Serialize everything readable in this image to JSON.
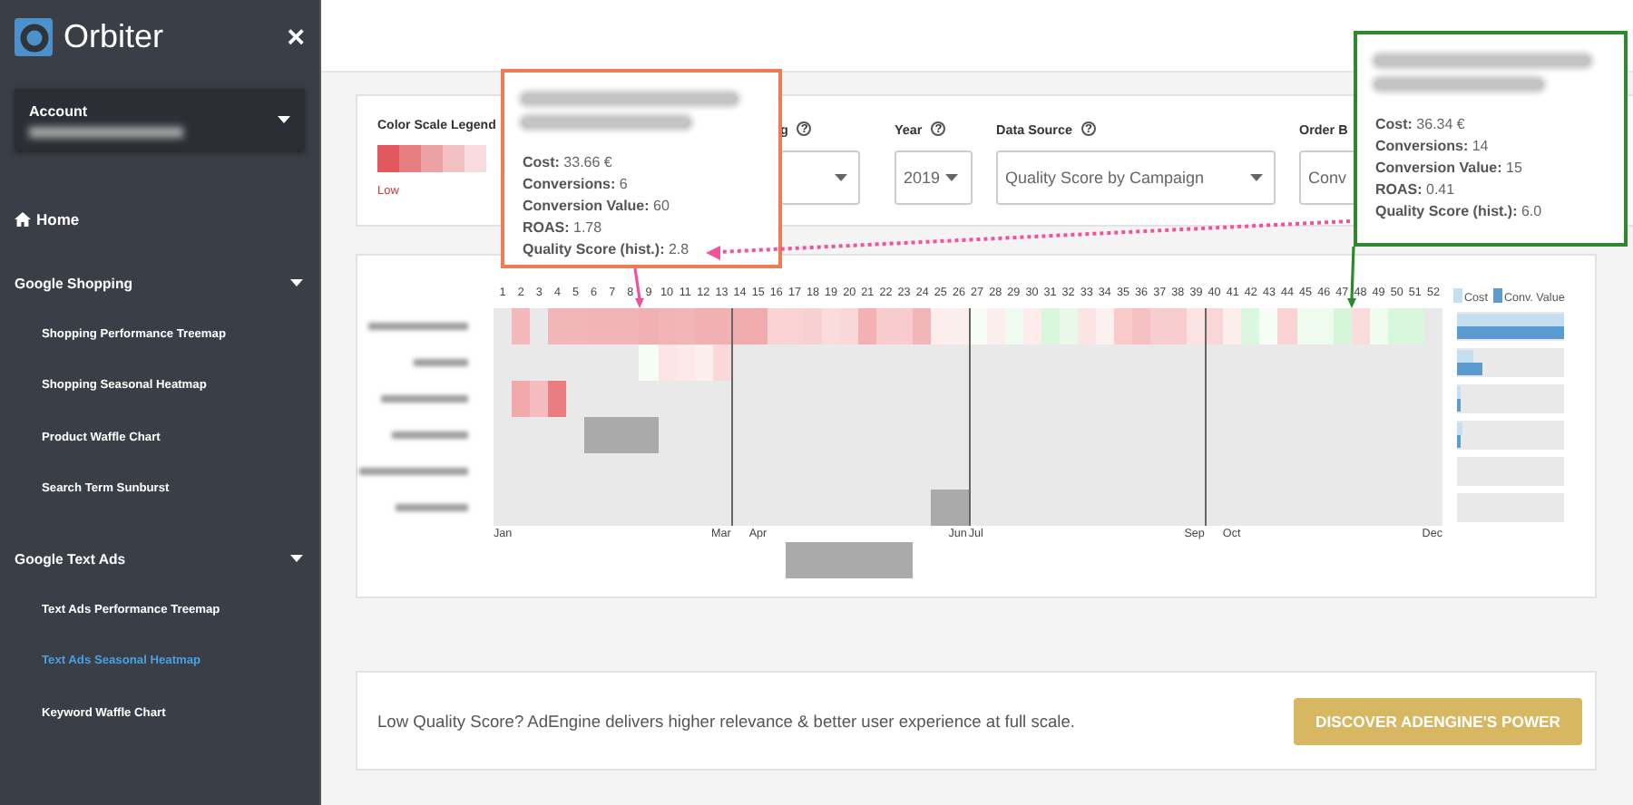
{
  "sidebar": {
    "logo": "Orbiter",
    "close": "×",
    "account": {
      "label": "Account"
    },
    "home": "Home",
    "sections": [
      {
        "label": "Google Shopping",
        "expanded": true,
        "items": [
          {
            "label": "Shopping Performance Treemap",
            "selected": false
          },
          {
            "label": "Shopping Seasonal Heatmap",
            "selected": false
          },
          {
            "label": "Product Waffle Chart",
            "selected": false
          },
          {
            "label": "Search Term Sunburst",
            "selected": false
          }
        ]
      },
      {
        "label": "Google Text Ads",
        "expanded": true,
        "items": [
          {
            "label": "Text Ads Performance Treemap",
            "selected": false
          },
          {
            "label": "Text Ads Seasonal Heatmap",
            "selected": true
          },
          {
            "label": "Keyword Waffle Chart",
            "selected": false
          }
        ]
      }
    ]
  },
  "filters": {
    "legend": {
      "label": "Color Scale Legend",
      "swatches": [
        {
          "color": "#e0585d"
        },
        {
          "color": "#e67e82"
        },
        {
          "color": "#eca1a4"
        },
        {
          "color": "#f2c0c2"
        },
        {
          "color": "#f8dcdd"
        }
      ],
      "note": "Low"
    },
    "fields": [
      {
        "kind": "select",
        "label": "g",
        "help": "?"
      },
      {
        "kind": "compact",
        "label": "Year",
        "help": "?",
        "value": "2019"
      },
      {
        "kind": "select",
        "label": "Data Source",
        "help": "?",
        "value": "Quality Score by Campaign"
      },
      {
        "kind": "cut",
        "label": "Order B",
        "value": "Conv"
      }
    ]
  },
  "heatmap": {
    "weeks": [
      "1",
      "2",
      "3",
      "4",
      "5",
      "6",
      "7",
      "8",
      "9",
      "10",
      "11",
      "12",
      "13",
      "14",
      "15",
      "16",
      "17",
      "18",
      "19",
      "20",
      "21",
      "22",
      "23",
      "24",
      "25",
      "26",
      "27",
      "28",
      "29",
      "30",
      "31",
      "32",
      "33",
      "34",
      "35",
      "36",
      "37",
      "38",
      "39",
      "40",
      "41",
      "42",
      "43",
      "44",
      "45",
      "46",
      "47",
      "48",
      "49",
      "50",
      "51",
      "52"
    ],
    "legend": [
      {
        "label": "Cost",
        "color": "#c6dff0"
      },
      {
        "label": "Conv. Value",
        "color": "#5b9bd0"
      }
    ],
    "rows": [
      {
        "kind": "row",
        "cost_bar": {
          "level": 1
        },
        "conv_bar": {
          "level": 1
        },
        "cells": [
          null,
          {
            "color": "#f4b8ba"
          },
          null,
          {
            "color": "#f2b6b8"
          },
          {
            "color": "#f2b6b8"
          },
          {
            "color": "#f2b4b6"
          },
          {
            "color": "#f2b4b6"
          },
          {
            "color": "#f2b4b6"
          },
          {
            "color": "#f1b1b3"
          },
          {
            "color": "#f2b4b6"
          },
          {
            "color": "#f2b6b8"
          },
          {
            "color": "#f1b0b2"
          },
          {
            "color": "#f1b0b2"
          },
          {
            "color": "#f0abad"
          },
          {
            "color": "#f0abad"
          },
          {
            "color": "#f9d3d4"
          },
          {
            "color": "#f9d3d4"
          },
          {
            "color": "#f9d0d1"
          },
          {
            "color": "#fbdcdd"
          },
          {
            "color": "#fad8d9"
          },
          {
            "color": "#f2b1b3"
          },
          {
            "color": "#f8cccd"
          },
          {
            "color": "#f8cccd"
          },
          {
            "color": "#f3b6b8"
          },
          {
            "color": "#fdeeee"
          },
          {
            "color": "#fdeeee"
          },
          {
            "color": "#f6fdf6"
          },
          {
            "color": "#fdeeee"
          },
          {
            "color": "#eefbee"
          },
          {
            "color": "#fdeced"
          },
          {
            "color": "#d9f7dc"
          },
          {
            "color": "#e8f9ea"
          },
          {
            "color": "#fce3e4"
          },
          {
            "color": "#fdf0f0"
          },
          {
            "color": "#f8caca"
          },
          {
            "color": "#f6c1c2"
          },
          {
            "color": "#f8cdce"
          },
          {
            "color": "#f8cdce"
          },
          {
            "color": "#fbe3e3"
          },
          {
            "color": "#f9d6d7"
          },
          {
            "color": "#fdeeee"
          },
          {
            "color": "#dcf7df"
          },
          {
            "color": "#f5fdf5"
          },
          {
            "color": "#fad4d5"
          },
          {
            "color": "#eefbee"
          },
          {
            "color": "#eefbee"
          },
          {
            "color": "#d6f6da"
          },
          {
            "color": "#fbdcdd"
          },
          {
            "color": "#f1fcf1"
          },
          {
            "color": "#d8f7dc"
          },
          {
            "color": "#d8f7dc"
          },
          null
        ]
      },
      {
        "kind": "row",
        "cost_bar": {
          "level": 0.15
        },
        "conv_bar": {
          "level": 0.24
        },
        "cells": [
          null,
          null,
          null,
          null,
          null,
          null,
          null,
          null,
          {
            "color": "#f5fdf5"
          },
          {
            "color": "#fce5e5"
          },
          {
            "color": "#fde9ea"
          },
          {
            "color": "#fdeeee"
          },
          {
            "color": "#fad8d9"
          }
        ]
      },
      {
        "kind": "row",
        "cost_bar": {
          "level": 0.03
        },
        "conv_bar": {
          "level": 0.03
        },
        "cells": [
          null,
          {
            "color": "#f1a9ab"
          },
          {
            "color": "#f4bcbe"
          },
          {
            "color": "#e97d80"
          }
        ]
      },
      {
        "kind": "row",
        "cost_bar": {
          "level": 0.05
        },
        "conv_bar": {
          "level": 0.03
        },
        "cells": [
          null,
          null,
          null,
          null,
          null,
          {
            "color": "#aaaaaa"
          },
          {
            "color": "#aaaaaa"
          },
          {
            "color": "#aaaaaa"
          },
          {
            "color": "#aaaaaa"
          }
        ]
      },
      {
        "kind": "row",
        "cost_bar": {
          "level": 0
        },
        "conv_bar": {
          "level": 0
        }
      },
      {
        "kind": "row",
        "cost_bar": {
          "level": 0
        },
        "conv_bar": {
          "level": 0
        },
        "cells": [
          null,
          null,
          null,
          null,
          null,
          null,
          null,
          null,
          null,
          null,
          null,
          null,
          null,
          null,
          null,
          null,
          null,
          null,
          null,
          null,
          null,
          null,
          null,
          null,
          {
            "color": "#aaaaaa"
          },
          {
            "color": "#aaaaaa"
          }
        ]
      },
      {
        "kind": "overflow",
        "cells": [
          null,
          null,
          null,
          null,
          null,
          null,
          null,
          null,
          null,
          null,
          null,
          null,
          null,
          null,
          null,
          null,
          {
            "color": "#aaaaaa"
          },
          {
            "color": "#aaaaaa"
          },
          {
            "color": "#aaaaaa"
          },
          {
            "color": "#aaaaaa"
          },
          {
            "color": "#aaaaaa"
          },
          {
            "color": "#aaaaaa"
          },
          {
            "color": "#aaaaaa"
          }
        ]
      }
    ],
    "months": [
      {
        "label": "Jan"
      },
      {
        "label": "Mar"
      },
      {
        "label": "Apr"
      },
      {
        "label": "Jun"
      },
      {
        "label": "Jul"
      },
      {
        "label": "Sep"
      },
      {
        "label": "Oct"
      },
      {
        "label": "Dec"
      }
    ]
  },
  "tooltips": [
    {
      "color": "#f07b4f",
      "lines": [
        "**Cost:** 33.66 €",
        "**Conversions:** 6",
        "**Conversion Value:** 60",
        "**ROAS:** 1.78",
        "**Quality Score (hist.):** 2.8"
      ]
    },
    {
      "color": "#2b8a2b",
      "lines": [
        "**Cost:** 36.34 €",
        "**Conversions:** 14",
        "**Conversion Value:** 15",
        "**ROAS:** 0.41",
        "**Quality Score (hist.):** 6.0"
      ]
    }
  ],
  "promo": {
    "text": "Low Quality Score? AdEngine delivers higher relevance & better user experience at full scale.",
    "button": "DISCOVER ADENGINE'S POWER"
  }
}
